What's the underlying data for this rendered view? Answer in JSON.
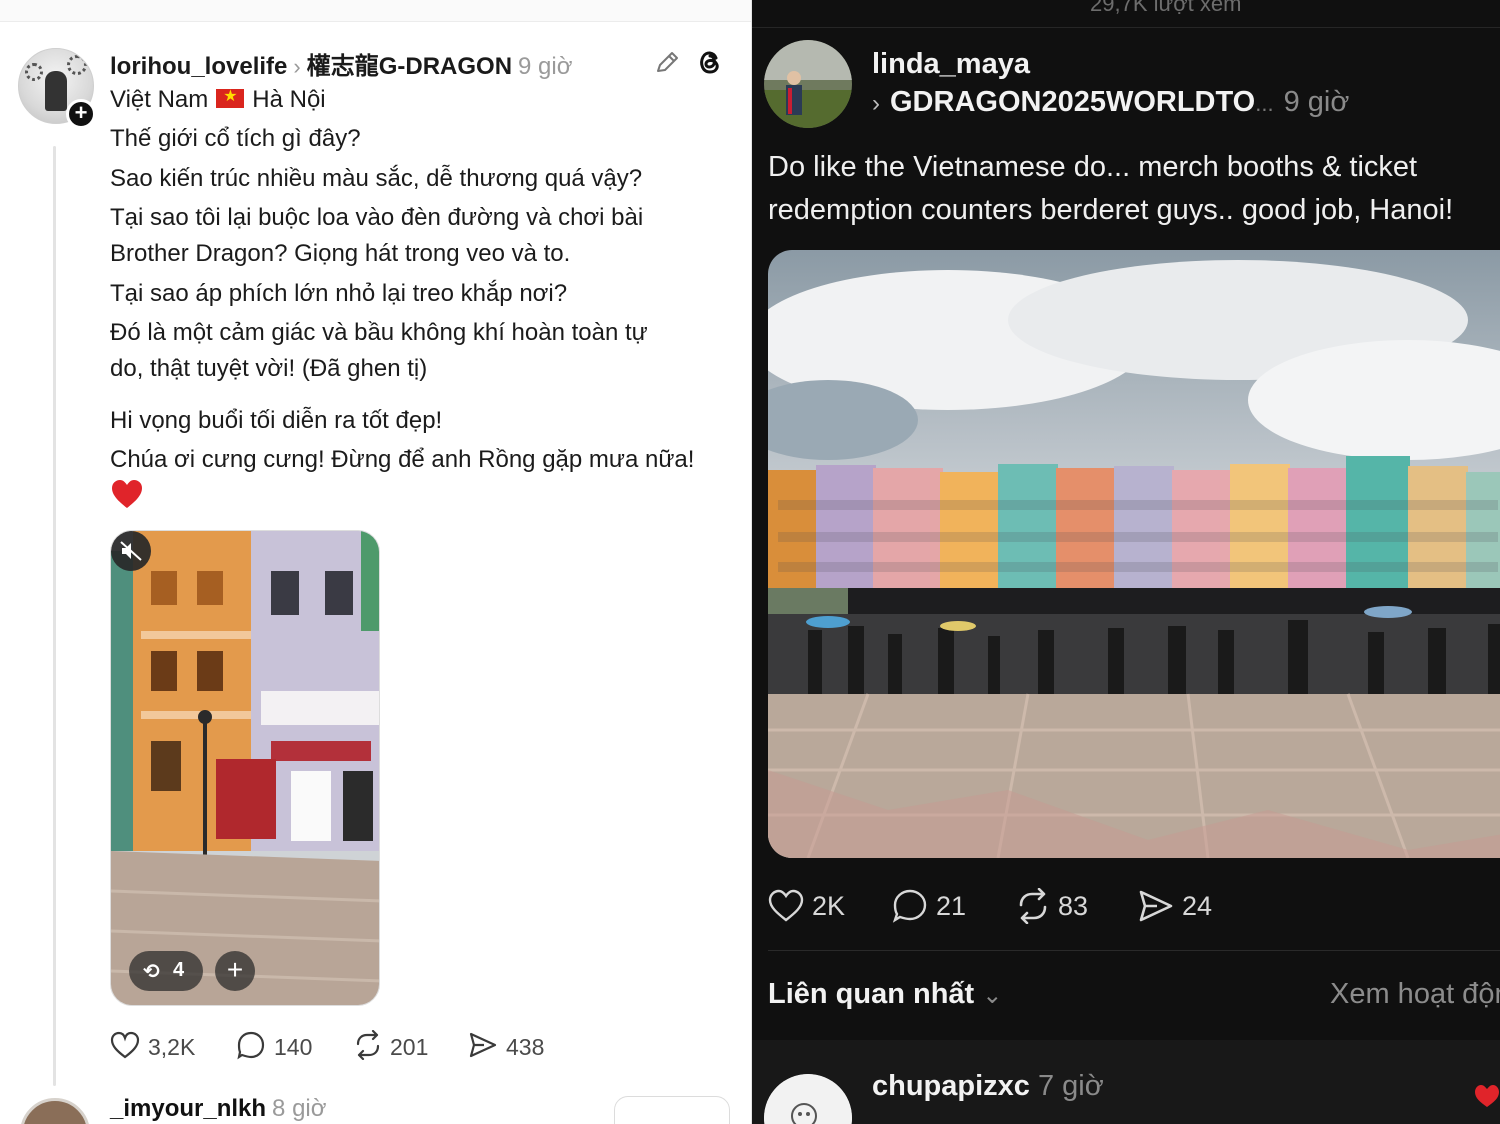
{
  "left": {
    "author": "lorihou_lovelife",
    "target": "權志龍G-DRAGON",
    "time": "9 giờ",
    "location_country": "Việt Nam",
    "location_city": "Hà Nội",
    "lines": [
      "Thế giới cổ tích gì đây?",
      "Sao kiến trúc nhiều màu sắc, dễ thương quá vậy?",
      "Tại sao tôi lại buộc loa vào đèn đường và chơi bài",
      "Brother Dragon? Giọng hát trong veo và to.",
      "Tại sao áp phích lớn nhỏ lại treo khắp nơi?",
      "Đó là một cảm giác và bầu không khí hoàn toàn tự",
      "do, thật tuyệt vời! (Đã ghen tị)",
      "Hi vọng buổi tối diễn ra tốt đẹp!",
      "Chúa ơi cưng cưng! Đừng để anh Rồng gặp mưa nữa!"
    ],
    "video_repost_count": "4",
    "likes": "3,2K",
    "comments": "140",
    "reposts": "201",
    "shares": "438",
    "next_author": "_imyour_nlkh",
    "next_time": "8 giờ"
  },
  "right": {
    "views": "29,7K lượt xem",
    "author": "linda_maya",
    "target": "GDRAGON2025WORLDTO",
    "target_ellipsis": "...",
    "time": "9 giờ",
    "lines": [
      "Do like the Vietnamese do... merch booths & ticket",
      "redemption counters berderet guys.. good job, Hanoi!"
    ],
    "likes": "2K",
    "comments": "21",
    "reposts": "83",
    "shares": "24",
    "sort_label": "Liên quan nhất",
    "activity_link": "Xem hoạt động",
    "comment_author": "chupapizxc",
    "comment_time": "7 giờ"
  },
  "colors": {
    "heart_red": "#e0242a",
    "dark_bg": "#101010",
    "light_bg": "#ffffff"
  },
  "icons": [
    "threads-icon",
    "edit-icon",
    "heart-icon",
    "comment-icon",
    "repost-icon",
    "share-icon",
    "mute-icon",
    "chevron-down-icon"
  ]
}
